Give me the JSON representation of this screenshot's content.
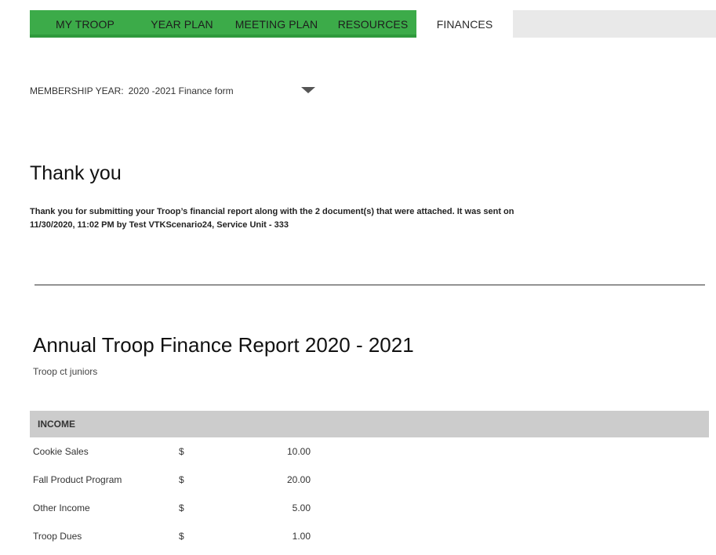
{
  "nav": {
    "tabs": [
      {
        "label": "MY TROOP"
      },
      {
        "label": "YEAR PLAN"
      },
      {
        "label": "MEETING PLAN"
      },
      {
        "label": "RESOURCES"
      },
      {
        "label": "FINANCES"
      }
    ],
    "active_tab": "FINANCES"
  },
  "membership": {
    "label": "MEMBERSHIP YEAR:",
    "selected": "2020 -2021 Finance form"
  },
  "thanks": {
    "title": "Thank you",
    "message_line1": "Thank you for submitting your Troop’s financial report along with the 2 document(s) that were attached. It was sent on",
    "message_line2": "11/30/2020, 11:02 PM by Test VTKScenario24, Service Unit - 333"
  },
  "report": {
    "title": "Annual Troop Finance Report 2020 - 2021",
    "troop": "Troop ct juniors"
  },
  "income": {
    "header": "INCOME",
    "rows": [
      {
        "label": "Cookie Sales",
        "currency": "$",
        "amount": "10.00"
      },
      {
        "label": "Fall Product Program",
        "currency": "$",
        "amount": "20.00"
      },
      {
        "label": "Other Income",
        "currency": "$",
        "amount": "5.00"
      },
      {
        "label": "Troop Dues",
        "currency": "$",
        "amount": "1.00"
      }
    ]
  },
  "colors": {
    "tab_green": "#3cab49",
    "nav_bg": "#e9e9e9",
    "section_header_bg": "#cccccc"
  }
}
